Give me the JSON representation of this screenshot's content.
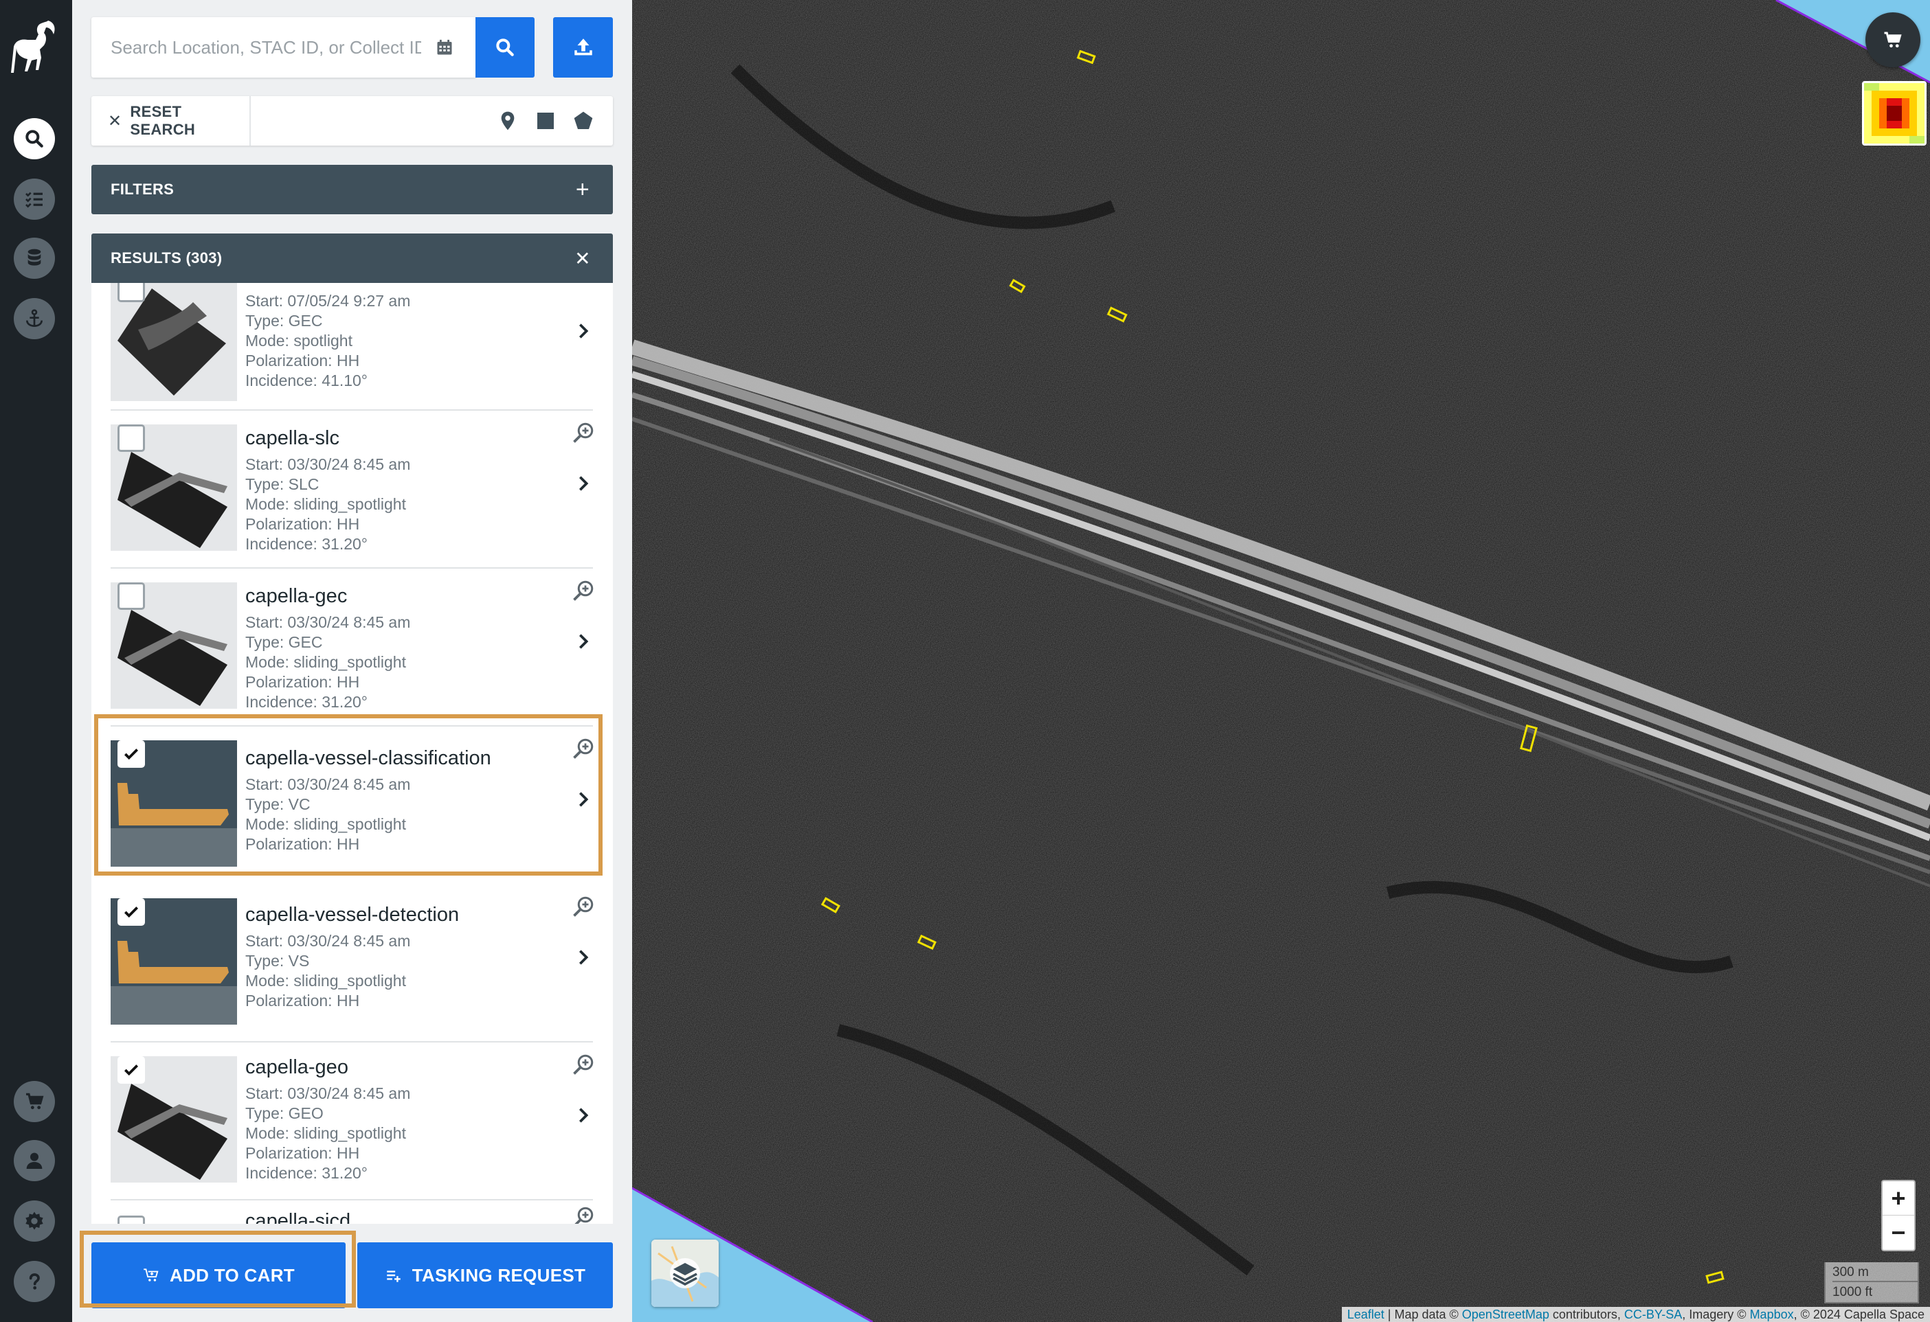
{
  "search": {
    "placeholder": "Search Location, STAC ID, or Collect ID"
  },
  "tools": {
    "reset_label": "RESET SEARCH"
  },
  "filters": {
    "label": "FILTERS"
  },
  "results": {
    "label": "RESULTS (303)",
    "items": [
      {
        "title": "",
        "checked": false,
        "meta": [
          "Start: 07/05/24 9:27 am",
          "Type: GEC",
          "Mode: spotlight",
          "Polarization: HH",
          "Incidence: 41.10°"
        ]
      },
      {
        "title": "capella-slc",
        "checked": false,
        "meta": [
          "Start: 03/30/24 8:45 am",
          "Type: SLC",
          "Mode: sliding_spotlight",
          "Polarization: HH",
          "Incidence: 31.20°"
        ]
      },
      {
        "title": "capella-gec",
        "checked": false,
        "meta": [
          "Start: 03/30/24 8:45 am",
          "Type: GEC",
          "Mode: sliding_spotlight",
          "Polarization: HH",
          "Incidence: 31.20°"
        ]
      },
      {
        "title": "capella-vessel-classification",
        "checked": true,
        "meta": [
          "Start: 03/30/24 8:45 am",
          "Type: VC",
          "Mode: sliding_spotlight",
          "Polarization: HH"
        ]
      },
      {
        "title": "capella-vessel-detection",
        "checked": true,
        "meta": [
          "Start: 03/30/24 8:45 am",
          "Type: VS",
          "Mode: sliding_spotlight",
          "Polarization: HH"
        ]
      },
      {
        "title": "capella-geo",
        "checked": true,
        "meta": [
          "Start: 03/30/24 8:45 am",
          "Type: GEO",
          "Mode: sliding_spotlight",
          "Polarization: HH",
          "Incidence: 31.20°"
        ]
      },
      {
        "title": "capella-sicd",
        "checked": false,
        "meta": []
      }
    ]
  },
  "actions": {
    "add_to_cart": "ADD TO CART",
    "tasking_request": "TASKING REQUEST"
  },
  "map": {
    "zoom_in": "+",
    "zoom_out": "−",
    "scale_metric": "300 m",
    "scale_imperial": "1000 ft",
    "attribution": {
      "leaflet": "Leaflet",
      "sep1": " | Map data © ",
      "osm": "OpenStreetMap",
      "contrib": " contributors, ",
      "license": "CC-BY-SA",
      "imagery": ", Imagery © ",
      "mapbox": "Mapbox",
      "capella": ", © 2024 Capella Space"
    }
  },
  "colors": {
    "accent": "#1a73e8",
    "highlight": "#d79b4a",
    "rail": "#1d2328",
    "section_bar": "#3f505b",
    "water": "#7cc8ec"
  }
}
